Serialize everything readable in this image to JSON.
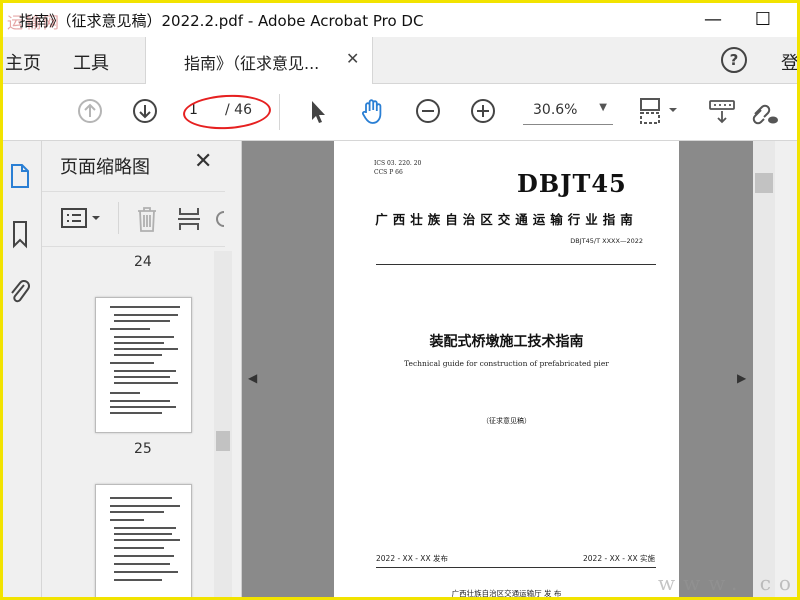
{
  "window": {
    "title": "指南》（征求意见稿）2022.2.pdf - Adobe Acrobat Pro DC",
    "minimize": "—",
    "maximize": "☐",
    "watermark_top": "运输网",
    "watermark_bottom": "www.        com"
  },
  "menubar": {
    "home": "主页",
    "tools": "工具",
    "doc_tab": "指南》（征求意见...",
    "doc_tab_close": "✕",
    "help": "?",
    "login": "登"
  },
  "toolbar": {
    "page_current": "1",
    "page_total": "/ 46",
    "zoom": "30.6%",
    "zoom_arrow": "▼"
  },
  "thumbnails": {
    "title": "页面缩略图",
    "close": "✕",
    "pages": [
      {
        "label": "24"
      },
      {
        "label": "25"
      }
    ]
  },
  "document": {
    "ics_line": "ICS  03. 220. 20",
    "ccs_line": "CCS  P  66",
    "code": "DBJT45",
    "org": "广西壮族自治区交通运输行业指南",
    "number": "DBJT45/T XXXX—2022",
    "title_cn": "装配式桥墩施工技术指南",
    "title_en": "Technical guide for construction of prefabricated pier",
    "draft": "（征求意见稿）",
    "issue": "2022 - XX - XX 发布",
    "implement": "2022 - XX - XX 实施",
    "publisher": "广西壮族自治区交通运输厅      发 布"
  },
  "colors": {
    "frame": "#f2e300",
    "annotation": "#e62020",
    "doc_bg": "#8a8a8a",
    "icon_blue": "#2a7fd4"
  }
}
